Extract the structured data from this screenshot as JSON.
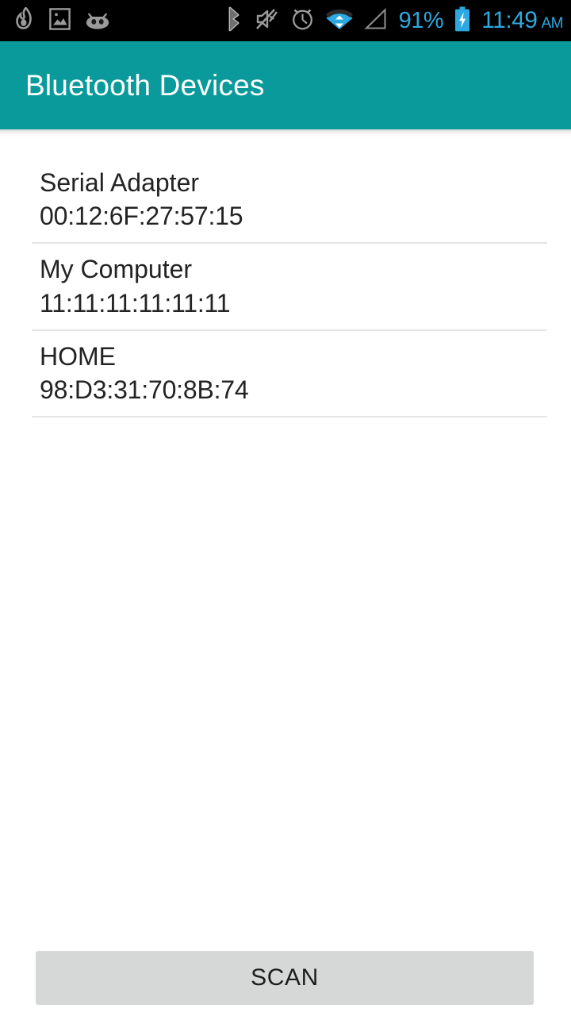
{
  "status_bar": {
    "background_color": "#000000",
    "accent_color": "#2ca9e0",
    "notification_icons": [
      {
        "name": "flame-icon",
        "label": "Flame notification"
      },
      {
        "name": "image-icon",
        "label": "Image notification"
      },
      {
        "name": "android-bean-face-icon",
        "label": "Android notification"
      }
    ],
    "system_icons": [
      {
        "name": "bluetooth-icon",
        "label": "Bluetooth on"
      },
      {
        "name": "volume-muted-icon",
        "label": "Sound muted"
      },
      {
        "name": "alarm-clock-icon",
        "label": "Alarm set"
      },
      {
        "name": "wifi-icon",
        "label": "Wi-Fi connected"
      },
      {
        "name": "cellular-signal-icon",
        "label": "No cellular signal"
      }
    ],
    "battery_percent": "91%",
    "battery_charging": true,
    "clock_time": "11:49",
    "clock_period": "AM"
  },
  "app_bar": {
    "title": "Bluetooth Devices",
    "background_color": "#0a9a9c",
    "title_color": "#ffffff"
  },
  "devices": [
    {
      "name": "Serial Adapter",
      "address": "00:12:6F:27:57:15"
    },
    {
      "name": "My Computer",
      "address": "11:11:11:11:11:11"
    },
    {
      "name": "HOME",
      "address": "98:D3:31:70:8B:74"
    }
  ],
  "scan_button": {
    "label": "SCAN",
    "background_color": "#d6d7d7",
    "text_color": "#1d1d1d"
  }
}
